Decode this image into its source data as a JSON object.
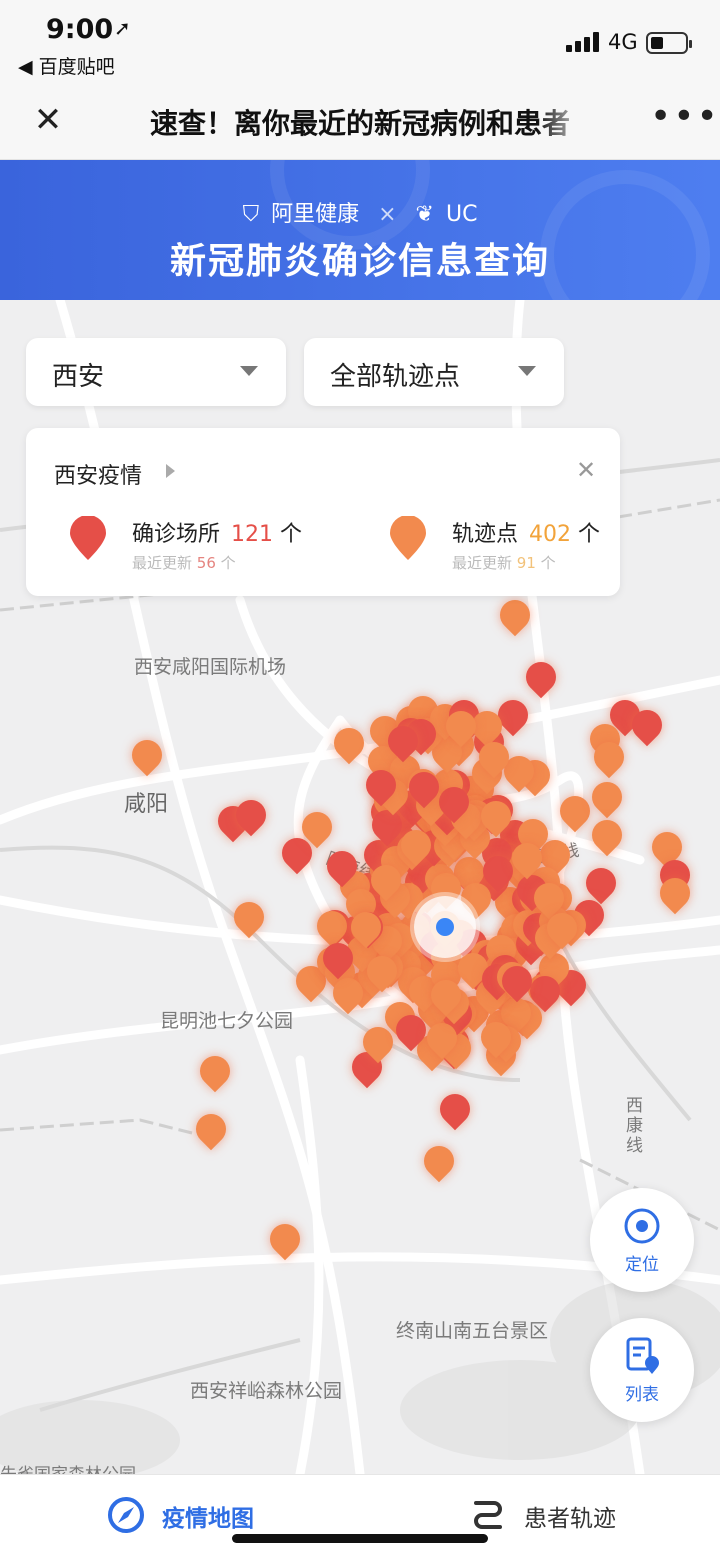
{
  "status_bar": {
    "time": "9:00",
    "location_arrow": "➚",
    "back_app": "◀ 百度贴吧",
    "network": "4G"
  },
  "nav": {
    "close_glyph": "✕",
    "title": "速查！离你最近的新冠病例和患者",
    "more_glyph": "•••"
  },
  "banner": {
    "brand_left": "阿里健康",
    "brand_sep": "×",
    "brand_right": "UC",
    "title": "新冠肺炎确诊信息查询"
  },
  "filters": {
    "city": "西安",
    "point_type": "全部轨迹点"
  },
  "summary": {
    "title": "西安疫情",
    "close_glyph": "✕",
    "confirmed": {
      "label": "确诊场所",
      "count": "121",
      "unit": "个",
      "recent_label": "最近更新",
      "recent_count": "56",
      "recent_unit": "个",
      "color": "#e54f48"
    },
    "trail": {
      "label": "轨迹点",
      "count": "402",
      "unit": "个",
      "recent_label": "最近更新",
      "recent_count": "91",
      "recent_unit": "个",
      "color": "#f2a33a"
    }
  },
  "map": {
    "places": {
      "airport": "西安咸阳国际机场",
      "xianyang": "咸阳",
      "kunming_lake": "昆明池七夕公园",
      "zhongnan": "终南山南五台景区",
      "xiangyu": "西安祥峪森林公园",
      "forest": "朱雀国家森林公园",
      "rail_a": "陇海线",
      "rail_b": "陇海线",
      "west_kang": "西康线"
    }
  },
  "fabs": {
    "locate": "定位",
    "list": "列表"
  },
  "tabs": {
    "map": "疫情地图",
    "trail": "患者轨迹"
  },
  "colors": {
    "accent": "#2f6ee4",
    "banner": "#3a64dc",
    "trail_marker": "#f28a4e",
    "confirmed_marker": "#e54f48"
  },
  "icons": {
    "locate": "crosshair-icon",
    "list": "list-doc-icon",
    "map_tab": "compass-icon",
    "trail_tab": "route-icon"
  }
}
